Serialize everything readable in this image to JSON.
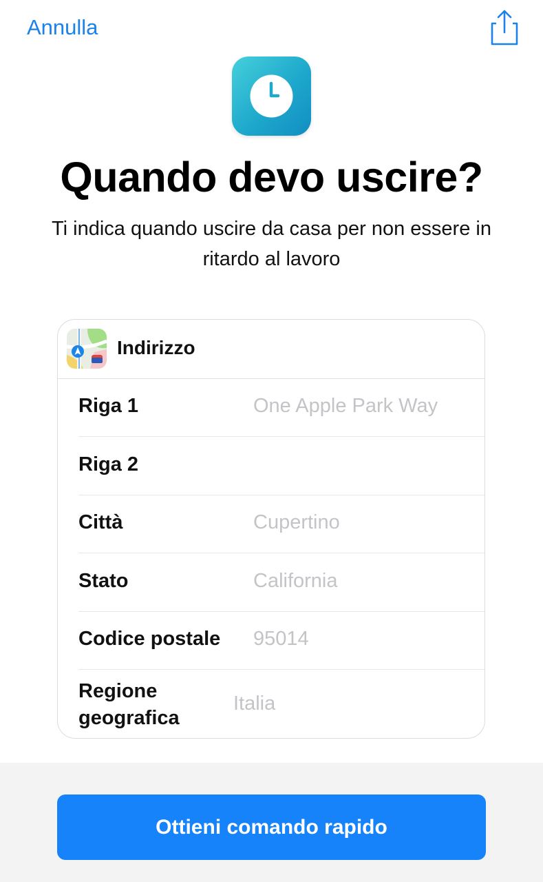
{
  "nav": {
    "cancel_label": "Annulla",
    "share_icon": "share-icon"
  },
  "shortcut": {
    "icon": "clock-icon",
    "icon_gradient": [
      "#45d0dc",
      "#118ec1"
    ],
    "title": "Quando devo uscire?",
    "description": "Ti indica quando uscire da casa per non essere in ritardo al lavoro"
  },
  "address_card": {
    "header_icon": "maps-app-icon",
    "header_label": "Indirizzo",
    "fields": [
      {
        "label": "Riga 1",
        "placeholder": "One Apple Park Way"
      },
      {
        "label": "Riga 2",
        "placeholder": ""
      },
      {
        "label": "Città",
        "placeholder": "Cupertino"
      },
      {
        "label": "Stato",
        "placeholder": "California"
      },
      {
        "label": "Codice postale",
        "placeholder": "95014"
      },
      {
        "label": "Regione geografica",
        "placeholder": "Italia"
      }
    ]
  },
  "footer": {
    "button_label": "Ottieni comando rapido",
    "button_color": "#1683fb"
  }
}
